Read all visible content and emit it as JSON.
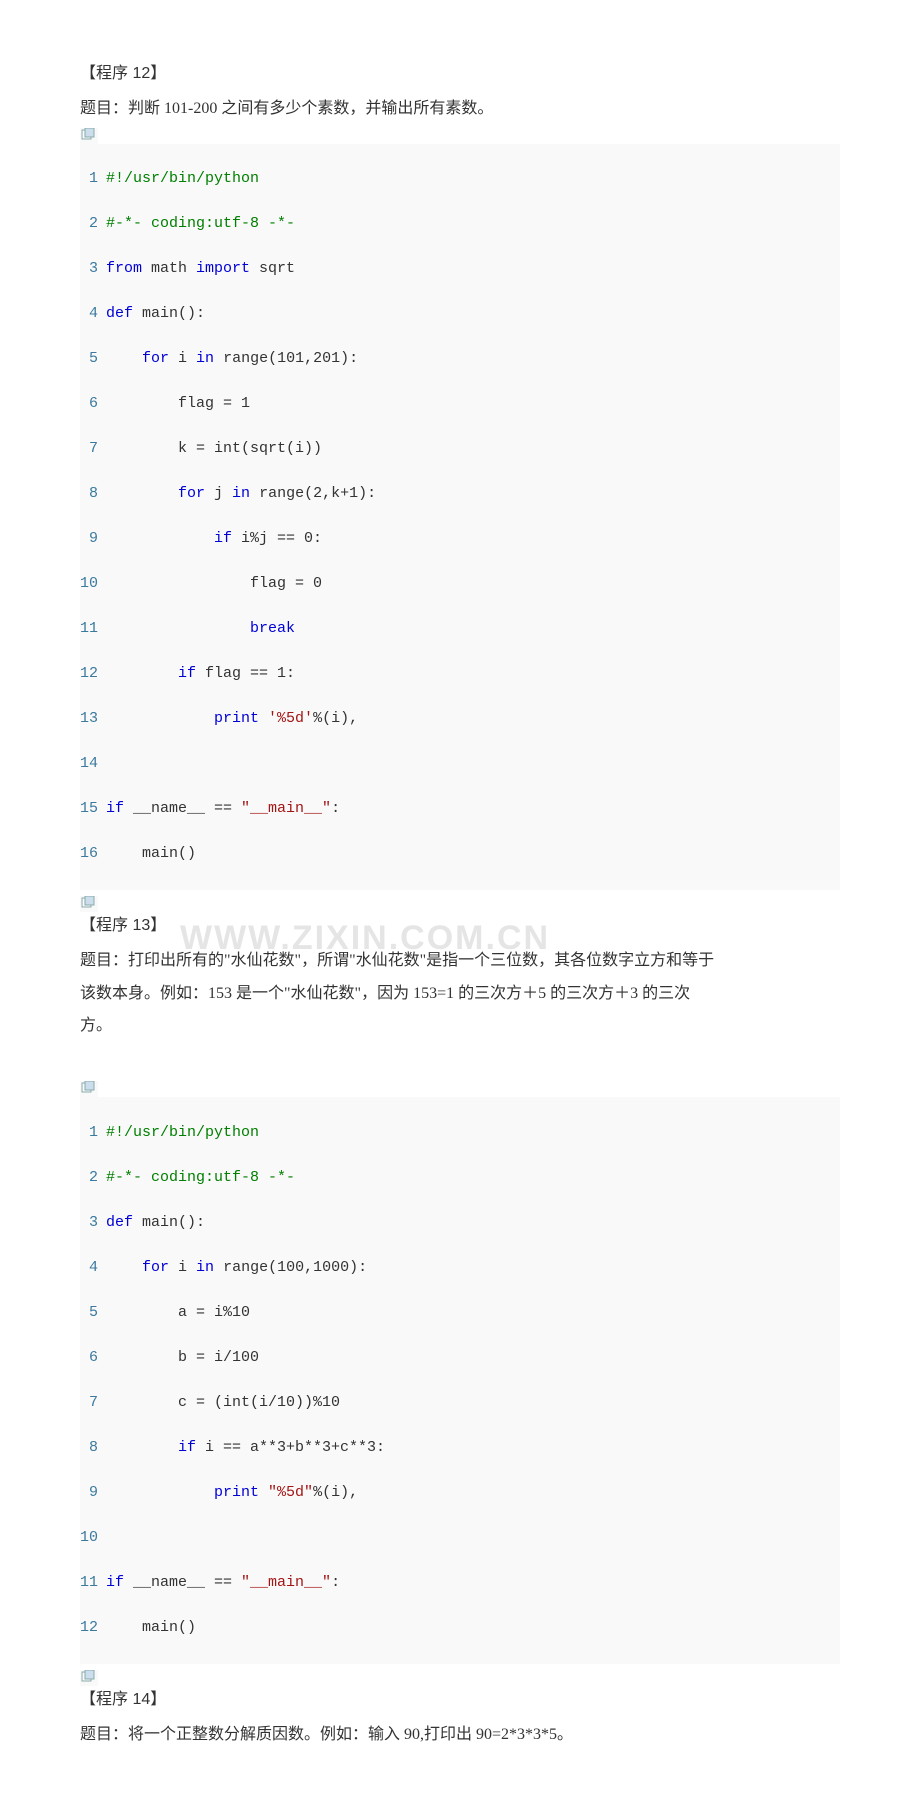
{
  "program12": {
    "title": "【程序 12】",
    "desc": "题目：判断 101-200 之间有多少个素数，并输出所有素数。"
  },
  "code12": {
    "l1_shebang": "#!/usr/bin/python",
    "l2_coding": "#-*- coding:utf-8 -*-",
    "l3_from": "from",
    "l3_math": " math ",
    "l3_import": "import",
    "l3_sqrt": " sqrt",
    "l4_def": "def",
    "l4_main": " main():",
    "l5_for": "for",
    "l5_i": " i ",
    "l5_in": "in",
    "l5_range": " range(101,201):",
    "l6_flag": " flag = 1",
    "l7_k": " k = int(sqrt(i))",
    "l8_for": "for",
    "l8_j": " j ",
    "l8_in": "in",
    "l8_range": " range(2,k+1):",
    "l9_if": "if",
    "l9_cond": " i%j == 0:",
    "l10_flag": " flag = 0",
    "l11_break": "break",
    "l12_if": "if",
    "l12_cond": " flag == 1:",
    "l13_print": "print",
    "l13_str": " '%5d'",
    "l13_tail": "%(i),",
    "l15_if": "if",
    "l15_name1": " __name__ ",
    "l15_eq": "== ",
    "l15_str": "\"__main__\"",
    "l15_colon": ":",
    "l16_main": " main()"
  },
  "program13": {
    "title": "【程序 13】",
    "desc1": "题目：打印出所有的\"水仙花数\"，所谓\"水仙花数\"是指一个三位数，其各位数字立方和等于",
    "desc2": "该数本身。例如：153 是一个\"水仙花数\"，因为 153=1 的三次方＋5 的三次方＋3 的三次",
    "desc3": "方。"
  },
  "code13": {
    "l1_shebang": "#!/usr/bin/python",
    "l2_coding": "#-*- coding:utf-8 -*-",
    "l3_def": "def",
    "l3_main": " main():",
    "l4_for": "for",
    "l4_i": " i ",
    "l4_in": "in",
    "l4_range": " range(100,1000):",
    "l5_a": " a = i%10",
    "l6_b": " b = i/100",
    "l7_c": " c = (int(i/10))%10",
    "l8_if": "if",
    "l8_cond": " i == a**3+b**3+c**3:",
    "l9_print": "print",
    "l9_str": " \"%5d\"",
    "l9_tail": "%(i),",
    "l11_if": "if",
    "l11_name1": " __name__ ",
    "l11_eq": "== ",
    "l11_str": "\"__main__\"",
    "l11_colon": ":",
    "l12_main": " main()"
  },
  "program14": {
    "title": "【程序 14】",
    "desc": "题目：将一个正整数分解质因数。例如：输入 90,打印出 90=2*3*3*5。"
  },
  "watermark": "WWW.ZIXIN.COM.CN",
  "linenos": {
    "n1": "1",
    "n2": "2",
    "n3": "3",
    "n4": "4",
    "n5": "5",
    "n6": "6",
    "n7": "7",
    "n8": "8",
    "n9": "9",
    "n10": "10",
    "n11": "11",
    "n12": "12",
    "n13": "13",
    "n14": "14",
    "n15": "15",
    "n16": "16"
  }
}
